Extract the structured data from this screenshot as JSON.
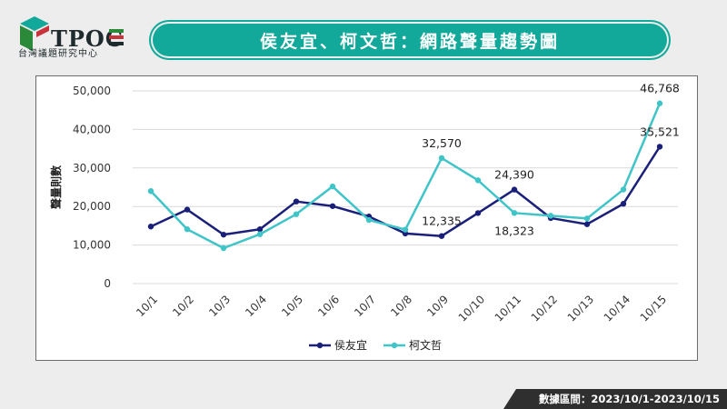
{
  "brand": {
    "name": "TPOC",
    "subtitle": "台灣議題研究中心",
    "colors": {
      "teal": "#12a89a",
      "green": "#2a8a3a",
      "red": "#c8323a",
      "dark": "#1f2a2e"
    }
  },
  "title": "侯友宜、柯文哲：網路聲量趨勢圖",
  "footer": "數據區間：2023/10/1-2023/10/15",
  "chart_data": {
    "type": "line",
    "title": "侯友宜、柯文哲：網路聲量趨勢圖",
    "ylabel": "聲量則數",
    "xlabel": "",
    "ylim": [
      0,
      50000
    ],
    "yticks": [
      0,
      10000,
      20000,
      30000,
      40000,
      50000
    ],
    "ytick_labels": [
      "0",
      "10,000",
      "20,000",
      "30,000",
      "40,000",
      "50,000"
    ],
    "grid": true,
    "legend": "bottom",
    "x": [
      "10/1",
      "10/2",
      "10/3",
      "10/4",
      "10/5",
      "10/6",
      "10/7",
      "10/8",
      "10/9",
      "10/10",
      "10/11",
      "10/12",
      "10/13",
      "10/14",
      "10/15"
    ],
    "series": [
      {
        "name": "侯友宜",
        "color": "#1a1f7a",
        "values": [
          14800,
          19200,
          12700,
          14100,
          21300,
          20100,
          17400,
          13000,
          12335,
          18300,
          24390,
          17000,
          15400,
          20700,
          35521
        ]
      },
      {
        "name": "柯文哲",
        "color": "#3fc4c8",
        "values": [
          24000,
          14100,
          9200,
          12800,
          18000,
          25200,
          16500,
          14000,
          32570,
          26800,
          18323,
          17600,
          16900,
          24400,
          46768
        ]
      }
    ],
    "annotations": [
      {
        "series": "柯文哲",
        "index": 8,
        "label": "32,570",
        "pos": "above"
      },
      {
        "series": "侯友宜",
        "index": 8,
        "label": "12,335",
        "pos": "above"
      },
      {
        "series": "侯友宜",
        "index": 10,
        "label": "24,390",
        "pos": "above"
      },
      {
        "series": "柯文哲",
        "index": 10,
        "label": "18,323",
        "pos": "below"
      },
      {
        "series": "柯文哲",
        "index": 14,
        "label": "46,768",
        "pos": "above"
      },
      {
        "series": "侯友宜",
        "index": 14,
        "label": "35,521",
        "pos": "above"
      }
    ]
  }
}
